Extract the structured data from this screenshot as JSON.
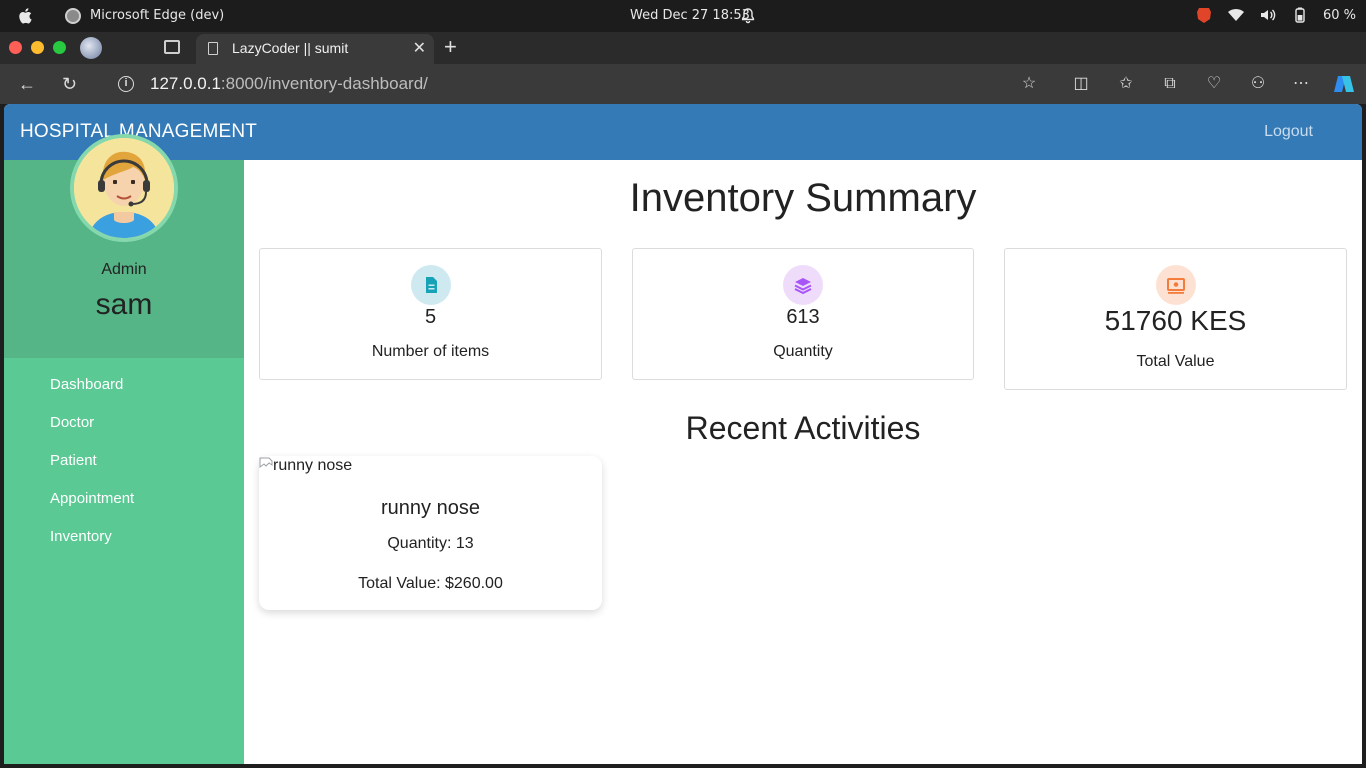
{
  "os": {
    "app_name": "Microsoft Edge (dev)",
    "clock": "Wed Dec 27  18:53",
    "battery": "60 %"
  },
  "browser": {
    "tab_title": "LazyCoder || sumit",
    "url_host": "127.0.0.1",
    "url_rest": ":8000/inventory-dashboard/"
  },
  "navbar": {
    "brand": "HOSPITAL MANAGEMENT",
    "logout": "Logout"
  },
  "sidebar": {
    "role": "Admin",
    "username": "sam",
    "items": [
      {
        "label": "Dashboard"
      },
      {
        "label": "Doctor"
      },
      {
        "label": "Patient"
      },
      {
        "label": "Appointment"
      },
      {
        "label": "Inventory"
      }
    ]
  },
  "main": {
    "title": "Inventory Summary",
    "cards": [
      {
        "value": "5",
        "label": "Number of items",
        "icon": "document-icon",
        "color": "#17a2b8"
      },
      {
        "value": "613",
        "label": "Quantity",
        "icon": "layers-icon",
        "color": "#a855f7"
      },
      {
        "value": "51760 KES",
        "label": "Total Value",
        "icon": "money-icon",
        "color": "#f47c3c"
      }
    ],
    "recent_title": "Recent Activities",
    "activity": {
      "image_alt": "runny nose",
      "name": "runny nose",
      "quantity": "Quantity: 13",
      "total": "Total Value: $260.00"
    }
  },
  "colors": {
    "navbar": "#337ab7",
    "sidebar": "#5ac994",
    "profile_box": "#55b587"
  }
}
